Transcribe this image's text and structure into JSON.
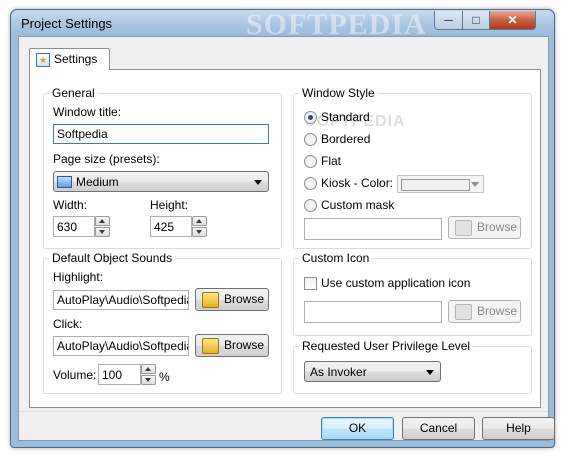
{
  "window": {
    "title": "Project Settings",
    "watermark": "SOFTPEDIA",
    "controls": {
      "minimize": "─",
      "maximize": "□",
      "close": "✕"
    }
  },
  "tabs": [
    {
      "label": "Settings",
      "icon": "settings-tab-icon"
    }
  ],
  "general": {
    "group_title": "General",
    "window_title_label": "Window title:",
    "window_title_value": "Softpedia",
    "page_size_label": "Page size (presets):",
    "page_size_value": "Medium",
    "width_label": "Width:",
    "width_value": "630",
    "height_label": "Height:",
    "height_value": "425"
  },
  "sounds": {
    "group_title": "Default Object Sounds",
    "highlight_label": "Highlight:",
    "highlight_value": "AutoPlay\\Audio\\Softpedia.c",
    "click_label": "Click:",
    "click_value": "AutoPlay\\Audio\\Softpedia_",
    "browse_label": "Browse",
    "volume_label": "Volume:",
    "volume_value": "100",
    "volume_unit": "%"
  },
  "window_style": {
    "group_title": "Window Style",
    "watermark": "SOFTPEDIA",
    "options": [
      "Standard",
      "Bordered",
      "Flat",
      "Kiosk - Color:",
      "Custom mask"
    ],
    "selected": "Standard",
    "browse_label": "Browse"
  },
  "custom_icon": {
    "group_title": "Custom Icon",
    "checkbox_label": "Use custom application icon",
    "browse_label": "Browse"
  },
  "privilege": {
    "group_title": "Requested User Privilege Level",
    "value": "As Invoker"
  },
  "buttons": {
    "ok": "OK",
    "cancel": "Cancel",
    "help": "Help"
  },
  "colors": {
    "window_frame": "#9dbcd9",
    "close_button": "#c75b3e",
    "default_button": "#3c7fb1"
  }
}
